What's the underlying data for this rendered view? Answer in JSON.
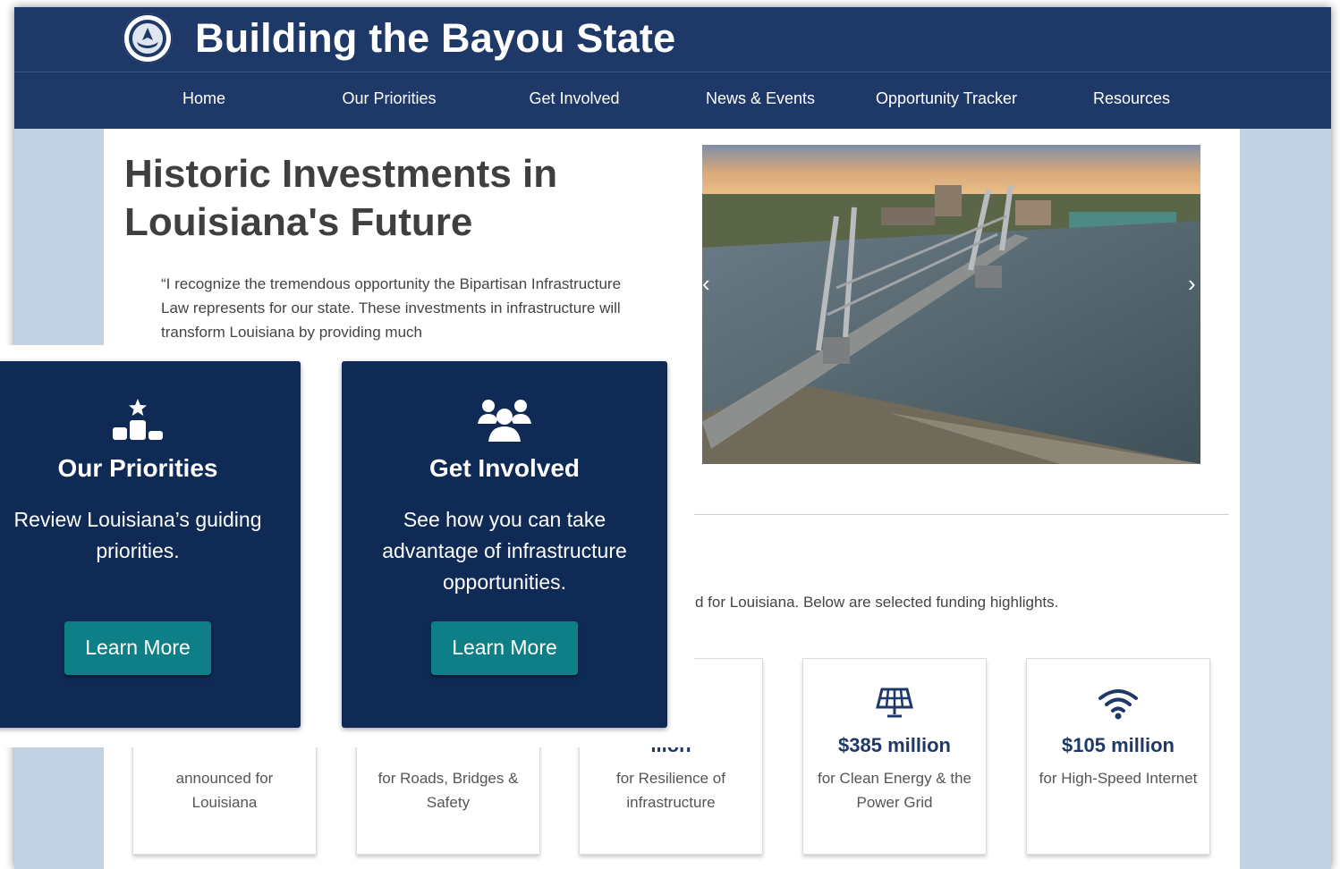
{
  "header": {
    "site_title": "Building the Bayou State",
    "seal_icon": "louisiana-state-seal-icon"
  },
  "nav": [
    {
      "label": "Home"
    },
    {
      "label": "Our Priorities"
    },
    {
      "label": "Get Involved"
    },
    {
      "label": "News & Events"
    },
    {
      "label": "Opportunity Tracker"
    },
    {
      "label": "Resources"
    }
  ],
  "hero": {
    "title": "Historic Investments in Louisiana's Future",
    "quote": "“I recognize the tremendous opportunity the Bipartisan Infrastructure Law represents for our state. These investments in infrastructure will transform Louisiana by providing much",
    "carousel_prev": "‹",
    "carousel_next": "›"
  },
  "funding": {
    "intro": "d for Louisiana. Below are selected funding highlights.",
    "cards": [
      {
        "amount": "",
        "desc": "announced for Louisiana"
      },
      {
        "amount": "",
        "desc": "for Roads, Bridges & Safety"
      },
      {
        "amount": "llion",
        "desc": "for Resilience of infrastructure"
      },
      {
        "amount": "$385 million",
        "desc": "for Clean Energy & the Power Grid",
        "icon": "solar-panel-icon"
      },
      {
        "amount": "$105 million",
        "desc": "for High-Speed Internet",
        "icon": "wifi-icon"
      }
    ]
  },
  "popup": {
    "cards": [
      {
        "icon": "podium-star-icon",
        "title": "Our Priorities",
        "desc": "Review Louisiana’s guiding priorities.",
        "button": "Learn More"
      },
      {
        "icon": "people-group-icon",
        "title": "Get Involved",
        "desc": "See how you can take advantage of infrastructure opportunities.",
        "button": "Learn More"
      }
    ]
  },
  "colors": {
    "header_bg": "#1e3868",
    "popup_card_bg": "#0f2a55",
    "button_teal": "#0e7f86",
    "page_bg": "#c3d2e2"
  }
}
